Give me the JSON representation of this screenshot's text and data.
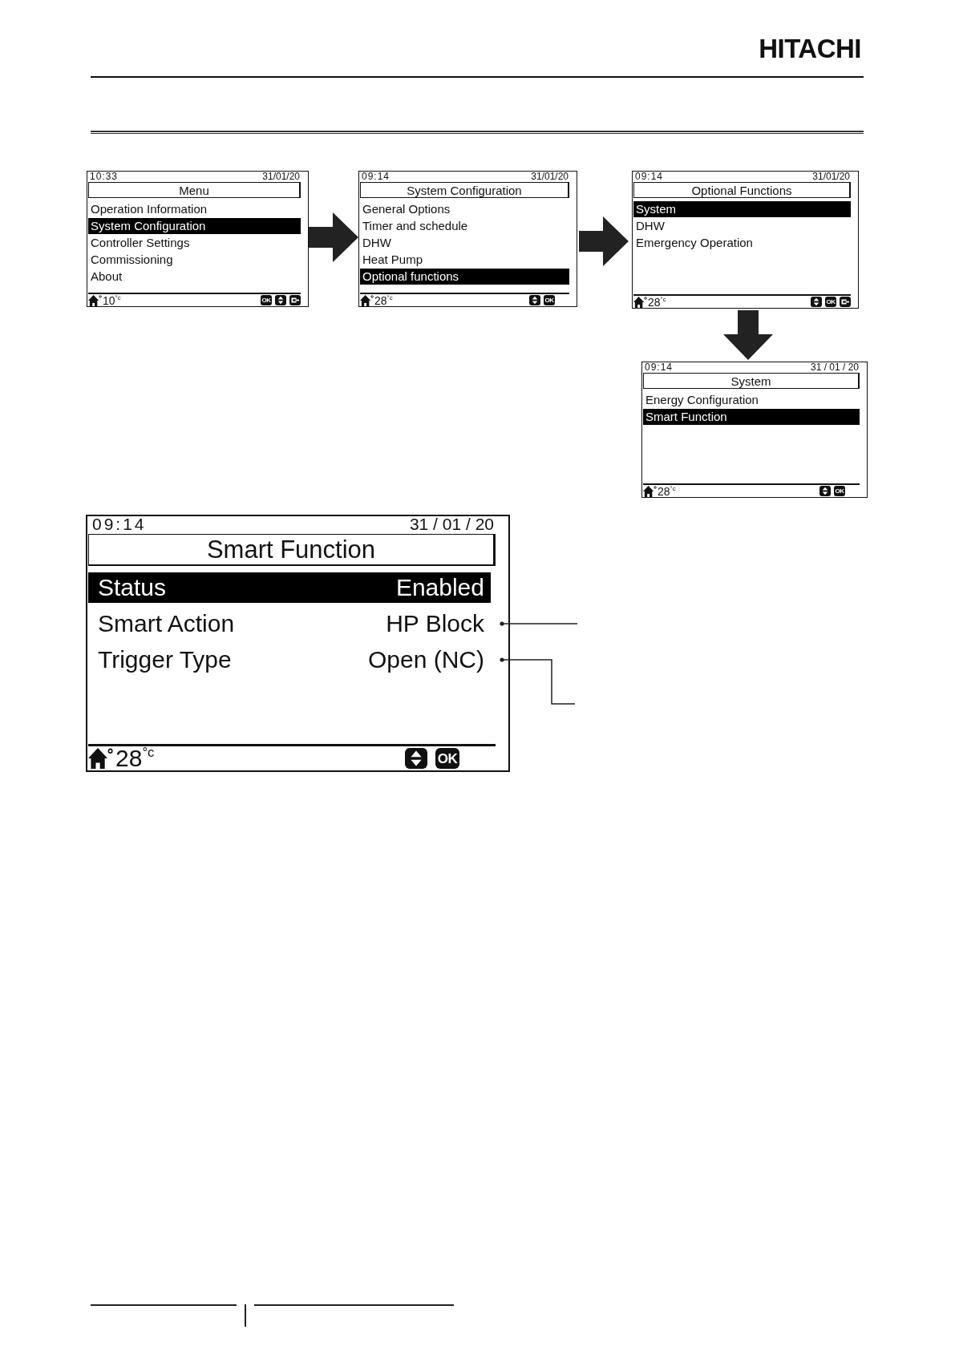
{
  "header": {
    "logo": "HITACHI"
  },
  "menu_screens": [
    {
      "time": "10:33",
      "date": "31/01/20",
      "title": "Menu",
      "items": [
        {
          "label": "Operation Information",
          "selected": false
        },
        {
          "label": "System Configuration",
          "selected": true
        },
        {
          "label": "Controller Settings",
          "selected": false
        },
        {
          "label": "Commissioning",
          "selected": false
        },
        {
          "label": "About",
          "selected": false
        }
      ],
      "temperature": "10$^{°c}$",
      "keys": [
        {
          "kind": "ok",
          "label": "OK"
        },
        {
          "kind": "updown"
        },
        {
          "kind": "back"
        }
      ]
    },
    {
      "time": "09:14",
      "date": "31/01/20",
      "title": "System Configuration",
      "items": [
        {
          "label": "General Options",
          "selected": false
        },
        {
          "label": "Timer and schedule",
          "selected": false
        },
        {
          "label": "DHW",
          "selected": false
        },
        {
          "label": "Heat Pump",
          "selected": false
        },
        {
          "label": "Optional functions",
          "selected": true
        }
      ],
      "temperature": "28$^{°c}$",
      "keys": [
        {
          "kind": "updown"
        },
        {
          "kind": "ok",
          "label": "OK"
        }
      ]
    },
    {
      "time": "09:14",
      "date": "31/01/20",
      "title": "Optional Functions",
      "items": [
        {
          "label": "System",
          "selected": true
        },
        {
          "label": "DHW",
          "selected": false
        },
        {
          "label": "Emergency Operation",
          "selected": false
        }
      ],
      "temperature": "28$^{°c}$",
      "keys": [
        {
          "kind": "updown"
        },
        {
          "kind": "ok",
          "label": "OK"
        },
        {
          "kind": "back"
        }
      ]
    },
    {
      "time": "09:14",
      "date": "31 / 01 / 20",
      "title": "System",
      "items": [
        {
          "label": "Energy Configuration",
          "selected": false
        },
        {
          "label": "Smart Function",
          "selected": true
        }
      ],
      "temperature": "28$^{°c}$",
      "keys": [
        {
          "kind": "updown"
        },
        {
          "kind": "ok",
          "label": "OK"
        }
      ]
    }
  ],
  "smart_function_screen": {
    "time": "09:14",
    "date": "31 / 01 / 20",
    "title": "Smart Function",
    "rows": [
      {
        "label": "Status",
        "value": "Enabled",
        "selected": true
      },
      {
        "label": "Smart Action",
        "value": "HP Block",
        "selected": false
      },
      {
        "label": "Trigger Type",
        "value": "Open (NC)",
        "selected": false
      }
    ],
    "temperature": "28$^{°c}$",
    "keys": [
      {
        "kind": "updown"
      },
      {
        "kind": "ok",
        "label": "OK"
      }
    ]
  }
}
